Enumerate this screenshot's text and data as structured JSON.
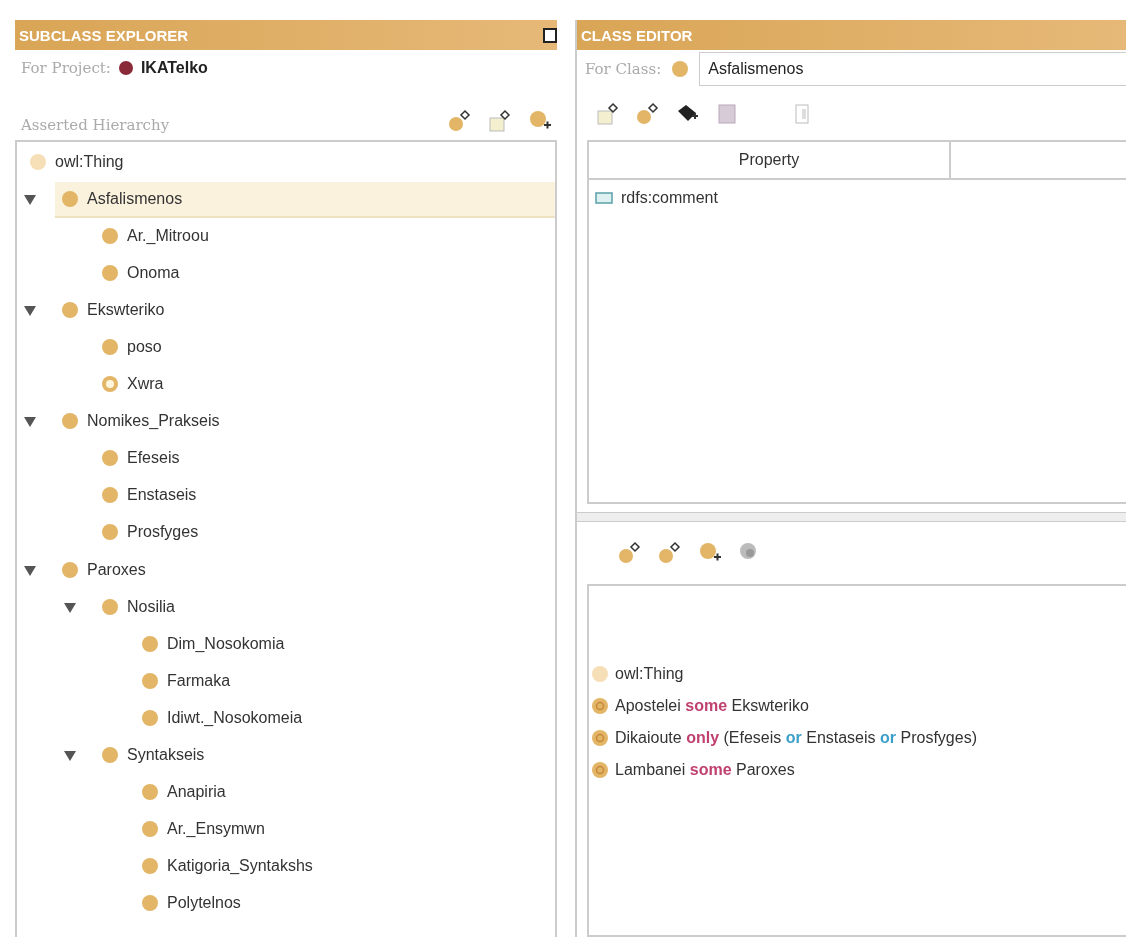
{
  "subclass_explorer": {
    "title": "SUBCLASS EXPLORER",
    "project_label": "For Project:",
    "project_name": "IKATelko",
    "hierarchy_label": "Asserted Hierarchy",
    "tree": [
      {
        "label": "owl:Thing",
        "kind": "root",
        "selected": false
      },
      {
        "label": "Asfalismenos",
        "kind": "class",
        "selected": true,
        "expanded": true,
        "children": [
          {
            "label": "Ar._Mitroou",
            "kind": "class",
            "selected": false
          },
          {
            "label": "Onoma",
            "kind": "class",
            "selected": false
          }
        ]
      },
      {
        "label": "Ekswteriko",
        "kind": "class",
        "selected": false,
        "expanded": true,
        "children": [
          {
            "label": "poso",
            "kind": "class",
            "selected": false
          },
          {
            "label": "Xwra",
            "kind": "hollow",
            "selected": false
          }
        ]
      },
      {
        "label": "Nomikes_Prakseis",
        "kind": "class",
        "selected": false,
        "expanded": true,
        "children": [
          {
            "label": "Efeseis",
            "kind": "class",
            "selected": false
          },
          {
            "label": "Enstaseis",
            "kind": "class",
            "selected": false
          },
          {
            "label": "Prosfyges",
            "kind": "class",
            "selected": false
          }
        ]
      },
      {
        "label": "Paroxes",
        "kind": "class",
        "selected": false,
        "expanded": true,
        "children": [
          {
            "label": "Nosilia",
            "kind": "class",
            "selected": false,
            "expanded": true,
            "children": [
              {
                "label": "Dim_Nosokomia",
                "kind": "class",
                "selected": false
              },
              {
                "label": "Farmaka",
                "kind": "class",
                "selected": false
              },
              {
                "label": "Idiwt._Nosokomeia",
                "kind": "class",
                "selected": false
              }
            ]
          },
          {
            "label": "Syntakseis",
            "kind": "class",
            "selected": false,
            "expanded": true,
            "children": [
              {
                "label": "Anapiria",
                "kind": "class",
                "selected": false
              },
              {
                "label": "Ar._Ensymwn",
                "kind": "class",
                "selected": false
              },
              {
                "label": "Katigoria_Syntakshs",
                "kind": "class",
                "selected": false
              },
              {
                "label": "Polytelnos",
                "kind": "class",
                "selected": false
              }
            ]
          }
        ]
      }
    ]
  },
  "class_editor": {
    "title": "CLASS EDITOR",
    "class_label": "For Class:",
    "class_name": "Asfalismenos",
    "table": {
      "columns": [
        "Property"
      ],
      "rows": [
        {
          "property": "rdfs:comment"
        }
      ]
    },
    "conditions": [
      {
        "kind": "root",
        "parts": [
          {
            "kind": "name",
            "text": "owl:Thing"
          }
        ]
      },
      {
        "kind": "some",
        "parts": [
          {
            "kind": "name",
            "text": "Apostelei"
          },
          {
            "kind": "keyword",
            "text": "some"
          },
          {
            "kind": "name",
            "text": "Ekswteriko"
          }
        ]
      },
      {
        "kind": "only",
        "parts": [
          {
            "kind": "name",
            "text": "Dikaioute"
          },
          {
            "kind": "keyword",
            "text": "only"
          },
          {
            "kind": "name",
            "text": "(Efeseis"
          },
          {
            "kind": "connective",
            "text": "or"
          },
          {
            "kind": "name",
            "text": "Enstaseis"
          },
          {
            "kind": "connective",
            "text": "or"
          },
          {
            "kind": "name",
            "text": "Prosfyges)"
          }
        ]
      },
      {
        "kind": "some",
        "parts": [
          {
            "kind": "name",
            "text": "Lambanei"
          },
          {
            "kind": "keyword",
            "text": "some"
          },
          {
            "kind": "name",
            "text": "Paroxes"
          }
        ]
      }
    ]
  }
}
